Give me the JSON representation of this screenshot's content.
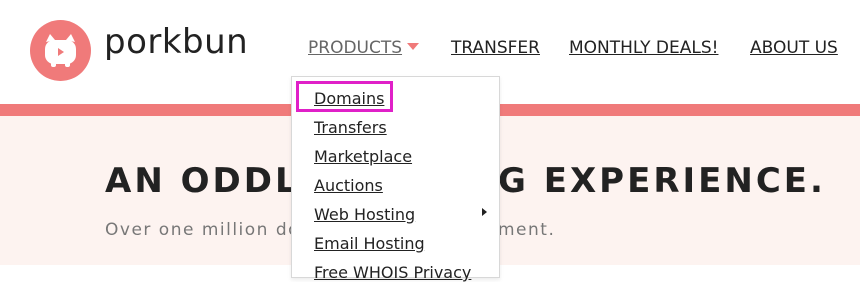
{
  "brand": {
    "name": "porkbun"
  },
  "nav": {
    "products": "PRODUCTS",
    "transfer": "TRANSFER",
    "deals": "MONTHLY DEALS!",
    "about": "ABOUT US"
  },
  "hero": {
    "headline_left": "AN ODDLY",
    "headline_right": "G EXPERIENCE.",
    "subtitle_left": "Over one million do",
    "subtitle_right": "ment."
  },
  "dropdown": {
    "items": [
      {
        "label": "Domains"
      },
      {
        "label": "Transfers"
      },
      {
        "label": "Marketplace"
      },
      {
        "label": "Auctions"
      },
      {
        "label": "Web Hosting"
      },
      {
        "label": "Email Hosting"
      },
      {
        "label": "Free WHOIS Privacy"
      }
    ]
  },
  "colors": {
    "brand": "#f07a7a",
    "highlight": "#e020c8",
    "hero_bg": "#fdf3f0"
  },
  "icons": {
    "logo": "pig-icon",
    "caret": "caret-down-icon",
    "submenu": "chevron-right-icon"
  }
}
